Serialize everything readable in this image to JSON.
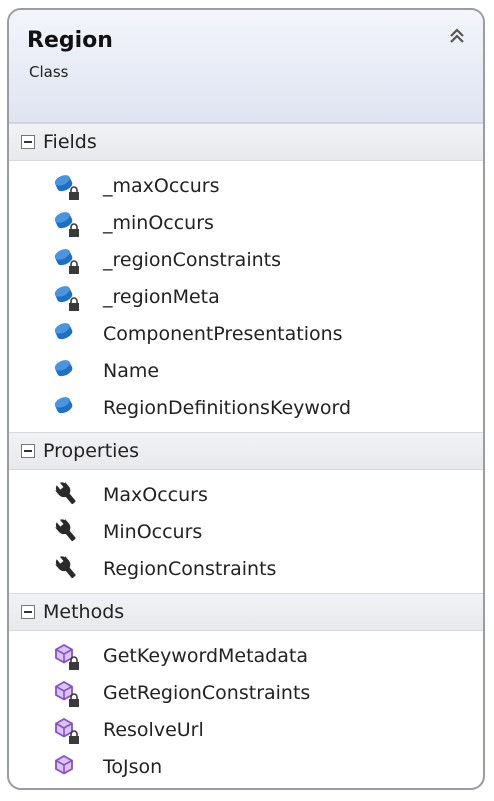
{
  "header": {
    "title": "Region",
    "subtitle": "Class"
  },
  "sections": {
    "fields": {
      "label": "Fields",
      "items": [
        {
          "label": "_maxOccurs",
          "icon": "private-field-icon"
        },
        {
          "label": "_minOccurs",
          "icon": "private-field-icon"
        },
        {
          "label": "_regionConstraints",
          "icon": "private-field-icon"
        },
        {
          "label": "_regionMeta",
          "icon": "private-field-icon"
        },
        {
          "label": "ComponentPresentations",
          "icon": "public-field-icon"
        },
        {
          "label": "Name",
          "icon": "public-field-icon"
        },
        {
          "label": "RegionDefinitionsKeyword",
          "icon": "public-field-icon"
        }
      ]
    },
    "properties": {
      "label": "Properties",
      "items": [
        {
          "label": "MaxOccurs",
          "icon": "property-wrench-icon"
        },
        {
          "label": "MinOccurs",
          "icon": "property-wrench-icon"
        },
        {
          "label": "RegionConstraints",
          "icon": "property-wrench-icon"
        }
      ]
    },
    "methods": {
      "label": "Methods",
      "items": [
        {
          "label": "GetKeywordMetadata",
          "icon": "private-method-icon"
        },
        {
          "label": "GetRegionConstraints",
          "icon": "private-method-icon"
        },
        {
          "label": "ResolveUrl",
          "icon": "private-method-icon"
        },
        {
          "label": "ToJson",
          "icon": "public-method-icon"
        }
      ]
    }
  },
  "colors": {
    "field_blue": "#1f6fc2",
    "method_purple": "#8a4fc7",
    "wrench": "#2a2a2a",
    "lock": "#3a3a3a"
  }
}
